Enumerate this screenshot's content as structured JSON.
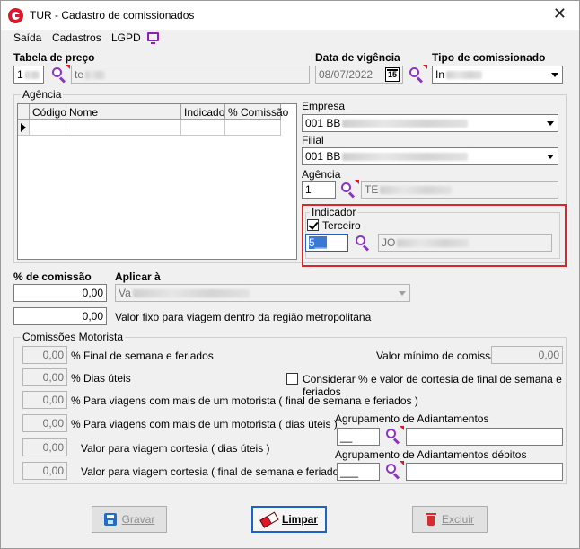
{
  "window": {
    "title": "TUR - Cadastro de comissionados",
    "close": "✕"
  },
  "menu": {
    "saida": "Saída",
    "cadastros": "Cadastros",
    "lgpd": "LGPD"
  },
  "tabela_preco": {
    "label": "Tabela de preço",
    "code": "1",
    "desc": "te"
  },
  "data_vigencia": {
    "label": "Data de vigência",
    "value": "08/07/2022",
    "cal": "15"
  },
  "tipo_comissionado": {
    "label": "Tipo de comissionado",
    "value": "In"
  },
  "agencia_group": {
    "title": "Agência",
    "columns": [
      "Código",
      "Nome",
      "Indicado",
      "% Comissão"
    ]
  },
  "empresa": {
    "label": "Empresa",
    "value": "001 BB"
  },
  "filial": {
    "label": "Filial",
    "value": "001 BB"
  },
  "agencia": {
    "label": "Agência",
    "code": "1",
    "desc": "TE"
  },
  "indicador": {
    "title": "Indicador",
    "terceiro_label": "Terceiro",
    "code": "5__",
    "desc": "JO"
  },
  "comissao": {
    "label": "% de comissão",
    "value": "0,00"
  },
  "aplicar": {
    "label": "Aplicar à",
    "value": "Va"
  },
  "valor_fixo": {
    "value": "0,00",
    "label": "Valor fixo para viagem dentro da região metropolitana"
  },
  "motorista": {
    "title": "Comissões Motorista",
    "fields": [
      {
        "value": "0,00",
        "label": "% Final de semana e feriados"
      },
      {
        "value": "0,00",
        "label": "% Dias úteis"
      },
      {
        "value": "0,00",
        "label": "% Para viagens com mais de um motorista ( final de semana e feriados )"
      },
      {
        "value": "0,00",
        "label": "% Para viagens com mais de um motorista ( dias úteis )"
      },
      {
        "value": "0,00",
        "label": "Valor para viagem cortesia ( dias úteis )"
      },
      {
        "value": "0,00",
        "label": "Valor para viagem cortesia ( final de semana e feriados )"
      }
    ],
    "valor_minimo_label": "Valor mínimo de comissão",
    "valor_minimo": "0,00",
    "considerar_label": "Considerar % e valor de cortesia de final de semana e feriados",
    "agrup_label": "Agrupamento de Adiantamentos",
    "agrup_code": "__",
    "agrup_debitos_label": "Agrupamento de Adiantamentos débitos",
    "agrup_debitos_code": "___"
  },
  "buttons": {
    "gravar": "Gravar",
    "limpar": "Limpar",
    "excluir": "Excluir"
  }
}
